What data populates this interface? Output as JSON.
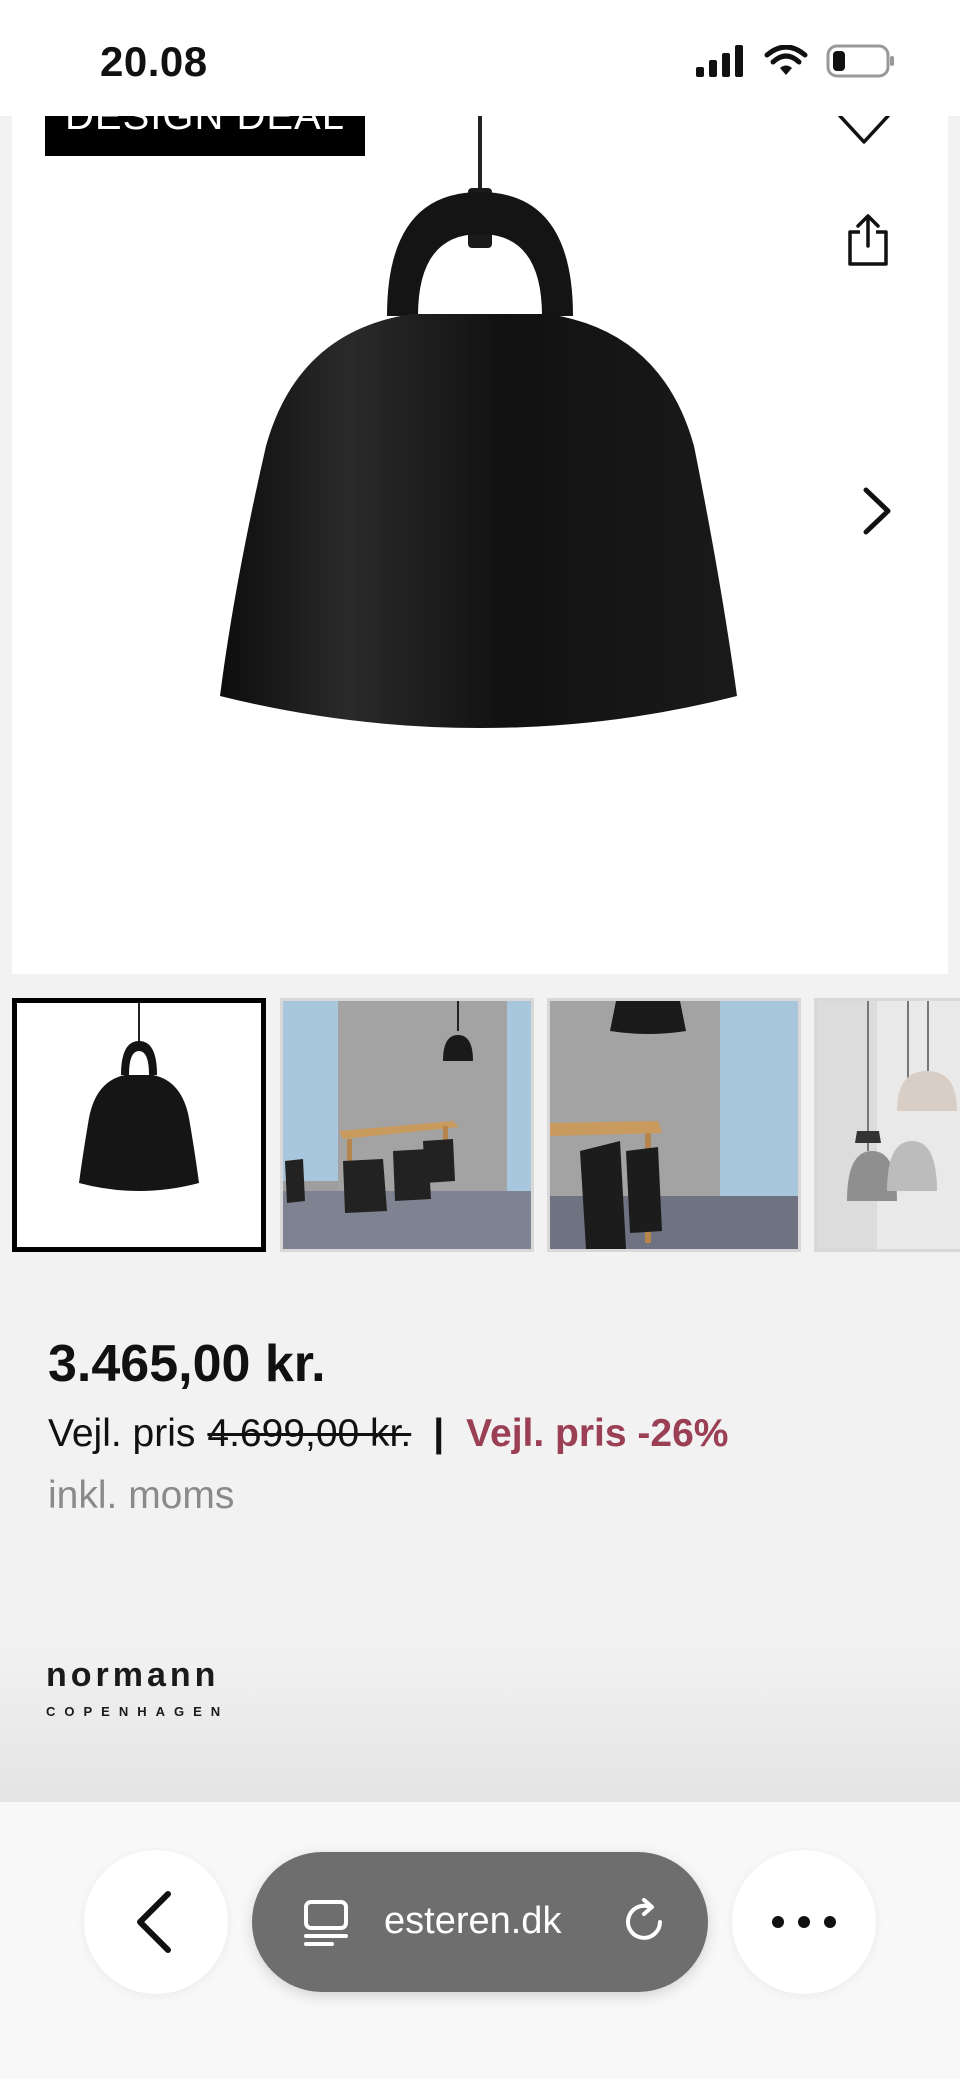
{
  "status_bar": {
    "time": "20.08"
  },
  "product": {
    "badge": "DESIGN DEAL",
    "price": "3.465,00 kr.",
    "rrp_label": "Vejl. pris",
    "rrp_value": "4.699,00 kr.",
    "separator": "|",
    "discount": "Vejl. pris -26%",
    "vat_note": "inkl. moms",
    "brand_name": "normann",
    "brand_sub": "COPENHAGEN"
  },
  "browser": {
    "url": "esteren.dk"
  },
  "colors": {
    "discount": "#9b3f55",
    "badge_bg": "#000000"
  },
  "icons": [
    "favorite-icon",
    "share-icon",
    "chevron-right-icon",
    "chevron-left-icon",
    "tabs-icon",
    "reload-icon",
    "more-icon"
  ]
}
